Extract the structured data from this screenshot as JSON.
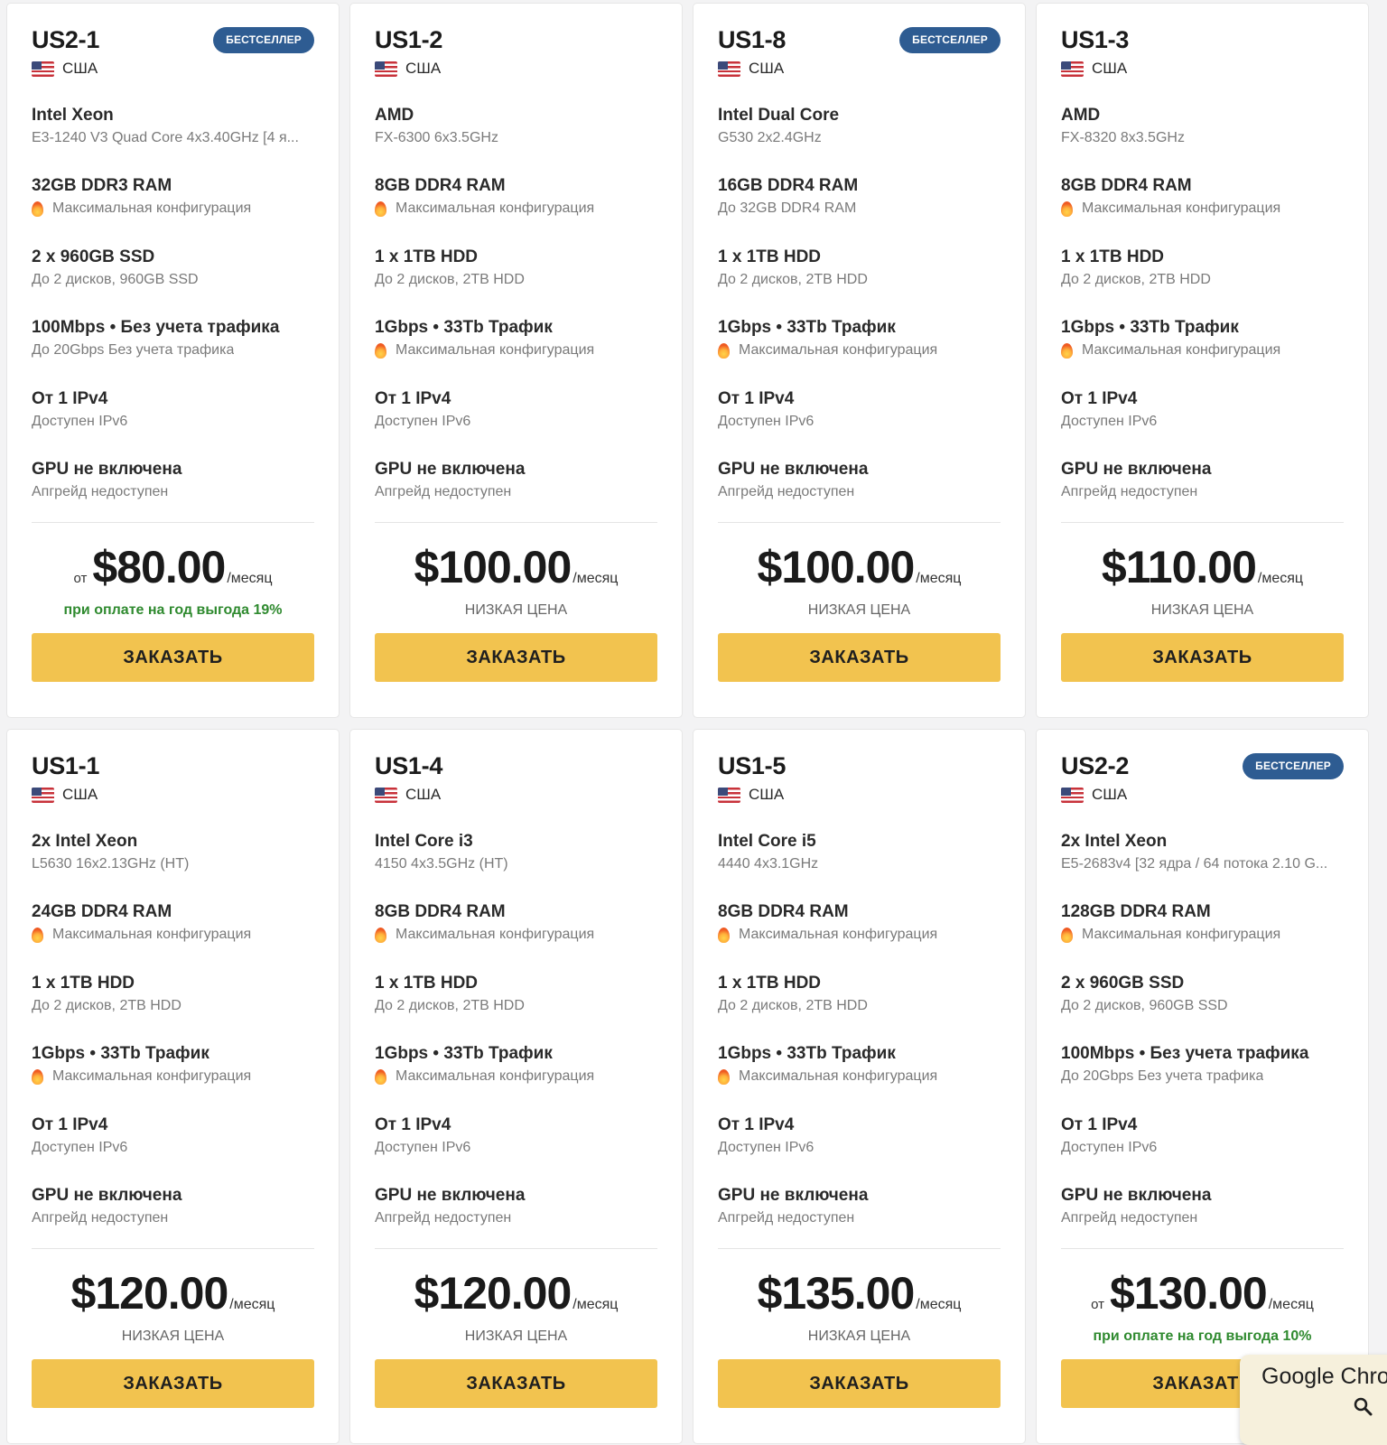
{
  "colors": {
    "accent_button": "#f2c34f",
    "badge": "#2e5c92",
    "promo_green": "#2f8a2f"
  },
  "icons": {
    "flag": "us-flag-icon",
    "fire": "fire-icon",
    "search": "search-icon"
  },
  "order_label": "ЗАКАЗАТЬ",
  "period_label": "/месяц",
  "cards": [
    {
      "name": "US2-1",
      "badge": "БЕСТСЕЛЛЕР",
      "country": "США",
      "specs": [
        {
          "main": "Intel Xeon",
          "sub": "E3-1240 V3 Quad Core 4x3.40GHz [4 я...",
          "fire": false
        },
        {
          "main": "32GB DDR3 RAM",
          "sub": "Максимальная конфигурация",
          "fire": true
        },
        {
          "main": "2 x 960GB SSD",
          "sub": "До 2 дисков, 960GB SSD",
          "fire": false
        },
        {
          "main": "100Mbps • Без учета трафика",
          "sub": "До 20Gbps Без учета трафика",
          "fire": false
        },
        {
          "main": "От 1 IPv4",
          "sub": "Доступен IPv6",
          "fire": false
        },
        {
          "main": "GPU не включена",
          "sub": "Апгрейд недоступен",
          "fire": false
        }
      ],
      "price_prefix": "от",
      "price": "$80.00",
      "note": "при оплате на год выгода 19%",
      "note_green": true
    },
    {
      "name": "US1-2",
      "badge": "",
      "country": "США",
      "specs": [
        {
          "main": "AMD",
          "sub": "FX-6300 6x3.5GHz",
          "fire": false
        },
        {
          "main": "8GB DDR4 RAM",
          "sub": "Максимальная конфигурация",
          "fire": true
        },
        {
          "main": "1 x 1TB HDD",
          "sub": "До 2 дисков, 2TB HDD",
          "fire": false
        },
        {
          "main": "1Gbps • 33Tb Трафик",
          "sub": "Максимальная конфигурация",
          "fire": true
        },
        {
          "main": "От 1 IPv4",
          "sub": "Доступен IPv6",
          "fire": false
        },
        {
          "main": "GPU не включена",
          "sub": "Апгрейд недоступен",
          "fire": false
        }
      ],
      "price_prefix": "",
      "price": "$100.00",
      "note": "НИЗКАЯ ЦЕНА",
      "note_green": false
    },
    {
      "name": "US1-8",
      "badge": "БЕСТСЕЛЛЕР",
      "country": "США",
      "specs": [
        {
          "main": "Intel Dual Core",
          "sub": "G530 2x2.4GHz",
          "fire": false
        },
        {
          "main": "16GB DDR4 RAM",
          "sub": "До 32GB DDR4 RAM",
          "fire": false
        },
        {
          "main": "1 x 1TB HDD",
          "sub": "До 2 дисков, 2TB HDD",
          "fire": false
        },
        {
          "main": "1Gbps • 33Tb Трафик",
          "sub": "Максимальная конфигурация",
          "fire": true
        },
        {
          "main": "От 1 IPv4",
          "sub": "Доступен IPv6",
          "fire": false
        },
        {
          "main": "GPU не включена",
          "sub": "Апгрейд недоступен",
          "fire": false
        }
      ],
      "price_prefix": "",
      "price": "$100.00",
      "note": "НИЗКАЯ ЦЕНА",
      "note_green": false
    },
    {
      "name": "US1-3",
      "badge": "",
      "country": "США",
      "specs": [
        {
          "main": "AMD",
          "sub": "FX-8320 8x3.5GHz",
          "fire": false
        },
        {
          "main": "8GB DDR4 RAM",
          "sub": "Максимальная конфигурация",
          "fire": true
        },
        {
          "main": "1 x 1TB HDD",
          "sub": "До 2 дисков, 2TB HDD",
          "fire": false
        },
        {
          "main": "1Gbps • 33Tb Трафик",
          "sub": "Максимальная конфигурация",
          "fire": true
        },
        {
          "main": "От 1 IPv4",
          "sub": "Доступен IPv6",
          "fire": false
        },
        {
          "main": "GPU не включена",
          "sub": "Апгрейд недоступен",
          "fire": false
        }
      ],
      "price_prefix": "",
      "price": "$110.00",
      "note": "НИЗКАЯ ЦЕНА",
      "note_green": false
    },
    {
      "name": "US1-1",
      "badge": "",
      "country": "США",
      "specs": [
        {
          "main": "2x Intel Xeon",
          "sub": "L5630 16x2.13GHz (HT)",
          "fire": false
        },
        {
          "main": "24GB DDR4 RAM",
          "sub": "Максимальная конфигурация",
          "fire": true
        },
        {
          "main": "1 x 1TB HDD",
          "sub": "До 2 дисков, 2TB HDD",
          "fire": false
        },
        {
          "main": "1Gbps • 33Tb Трафик",
          "sub": "Максимальная конфигурация",
          "fire": true
        },
        {
          "main": "От 1 IPv4",
          "sub": "Доступен IPv6",
          "fire": false
        },
        {
          "main": "GPU не включена",
          "sub": "Апгрейд недоступен",
          "fire": false
        }
      ],
      "price_prefix": "",
      "price": "$120.00",
      "note": "НИЗКАЯ ЦЕНА",
      "note_green": false
    },
    {
      "name": "US1-4",
      "badge": "",
      "country": "США",
      "specs": [
        {
          "main": "Intel Core i3",
          "sub": "4150 4x3.5GHz (HT)",
          "fire": false
        },
        {
          "main": "8GB DDR4 RAM",
          "sub": "Максимальная конфигурация",
          "fire": true
        },
        {
          "main": "1 x 1TB HDD",
          "sub": "До 2 дисков, 2TB HDD",
          "fire": false
        },
        {
          "main": "1Gbps • 33Tb Трафик",
          "sub": "Максимальная конфигурация",
          "fire": true
        },
        {
          "main": "От 1 IPv4",
          "sub": "Доступен IPv6",
          "fire": false
        },
        {
          "main": "GPU не включена",
          "sub": "Апгрейд недоступен",
          "fire": false
        }
      ],
      "price_prefix": "",
      "price": "$120.00",
      "note": "НИЗКАЯ ЦЕНА",
      "note_green": false
    },
    {
      "name": "US1-5",
      "badge": "",
      "country": "США",
      "specs": [
        {
          "main": "Intel Core i5",
          "sub": "4440 4x3.1GHz",
          "fire": false
        },
        {
          "main": "8GB DDR4 RAM",
          "sub": "Максимальная конфигурация",
          "fire": true
        },
        {
          "main": "1 x 1TB HDD",
          "sub": "До 2 дисков, 2TB HDD",
          "fire": false
        },
        {
          "main": "1Gbps • 33Tb Трафик",
          "sub": "Максимальная конфигурация",
          "fire": true
        },
        {
          "main": "От 1 IPv4",
          "sub": "Доступен IPv6",
          "fire": false
        },
        {
          "main": "GPU не включена",
          "sub": "Апгрейд недоступен",
          "fire": false
        }
      ],
      "price_prefix": "",
      "price": "$135.00",
      "note": "НИЗКАЯ ЦЕНА",
      "note_green": false
    },
    {
      "name": "US2-2",
      "badge": "БЕСТСЕЛЛЕР",
      "country": "США",
      "specs": [
        {
          "main": "2x Intel Xeon",
          "sub": "E5-2683v4 [32 ядра / 64 потока 2.10 G...",
          "fire": false
        },
        {
          "main": "128GB DDR4 RAM",
          "sub": "Максимальная конфигурация",
          "fire": true
        },
        {
          "main": "2 x 960GB SSD",
          "sub": "До 2 дисков, 960GB SSD",
          "fire": false
        },
        {
          "main": "100Mbps • Без учета трафика",
          "sub": "До 20Gbps Без учета трафика",
          "fire": false
        },
        {
          "main": "От 1 IPv4",
          "sub": "Доступен IPv6",
          "fire": false
        },
        {
          "main": "GPU не включена",
          "sub": "Апгрейд недоступен",
          "fire": false
        }
      ],
      "price_prefix": "от",
      "price": "$130.00",
      "note": "при оплате на год выгода 10%",
      "note_green": true
    }
  ],
  "chrome_popup": {
    "text": "Google Chrome"
  }
}
